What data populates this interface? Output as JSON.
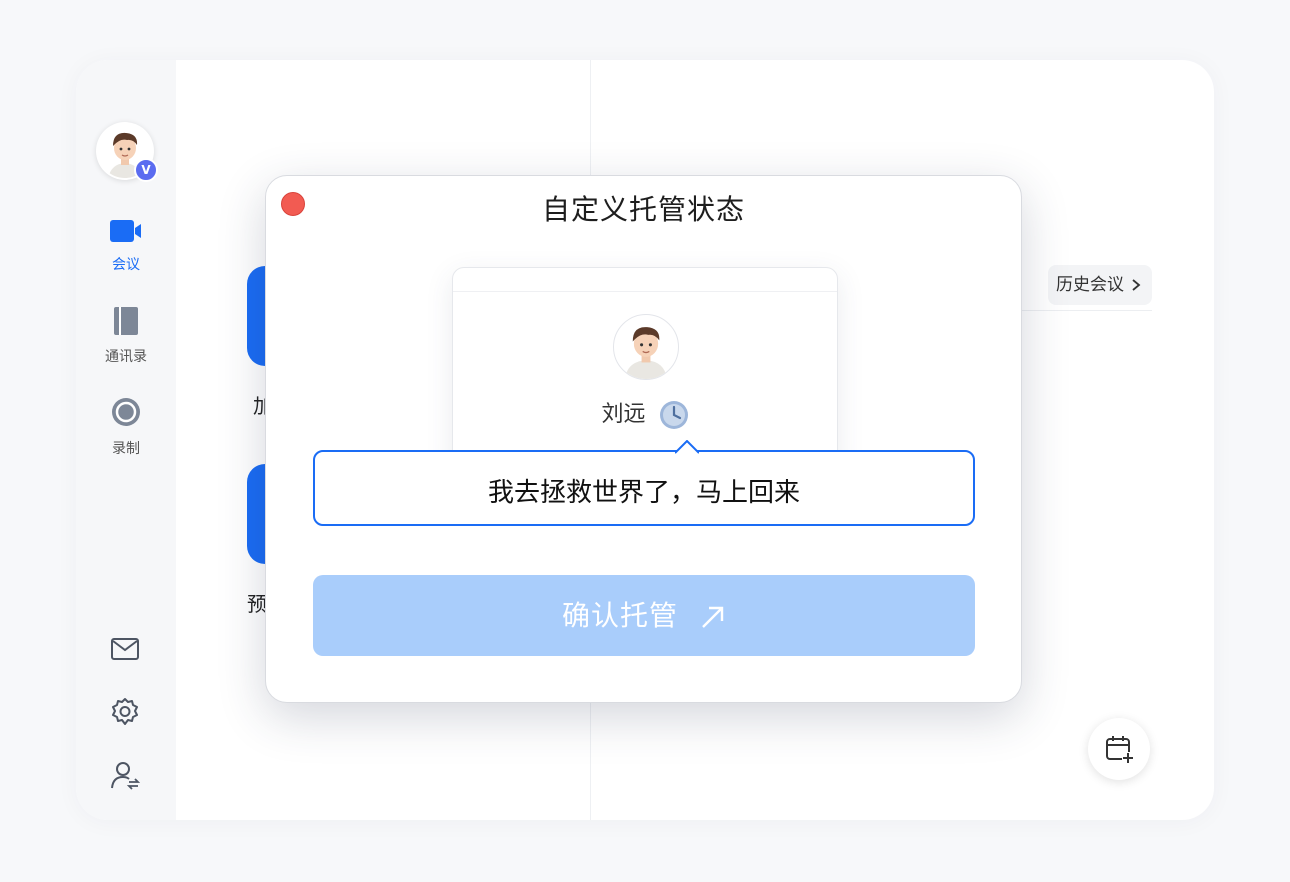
{
  "sidebar": {
    "verified_badge": "V",
    "nav": [
      {
        "label": "会议",
        "icon": "video-camera-icon"
      },
      {
        "label": "通讯录",
        "icon": "book-icon"
      },
      {
        "label": "录制",
        "icon": "record-icon"
      }
    ],
    "bottom_icons": [
      "mail-icon",
      "settings-gear-icon",
      "user-switch-icon"
    ]
  },
  "main": {
    "history_button": "历史会议",
    "tile_labels": [
      "加",
      "预"
    ]
  },
  "modal": {
    "title": "自定义托管状态",
    "preview": {
      "name": "刘远"
    },
    "status_text": "我去拯救世界了，马上回来",
    "confirm_label": "确认托管"
  },
  "colors": {
    "accent": "#1a6cf5",
    "confirm_disabled": "#a9cdfb",
    "close": "#f25b52"
  }
}
